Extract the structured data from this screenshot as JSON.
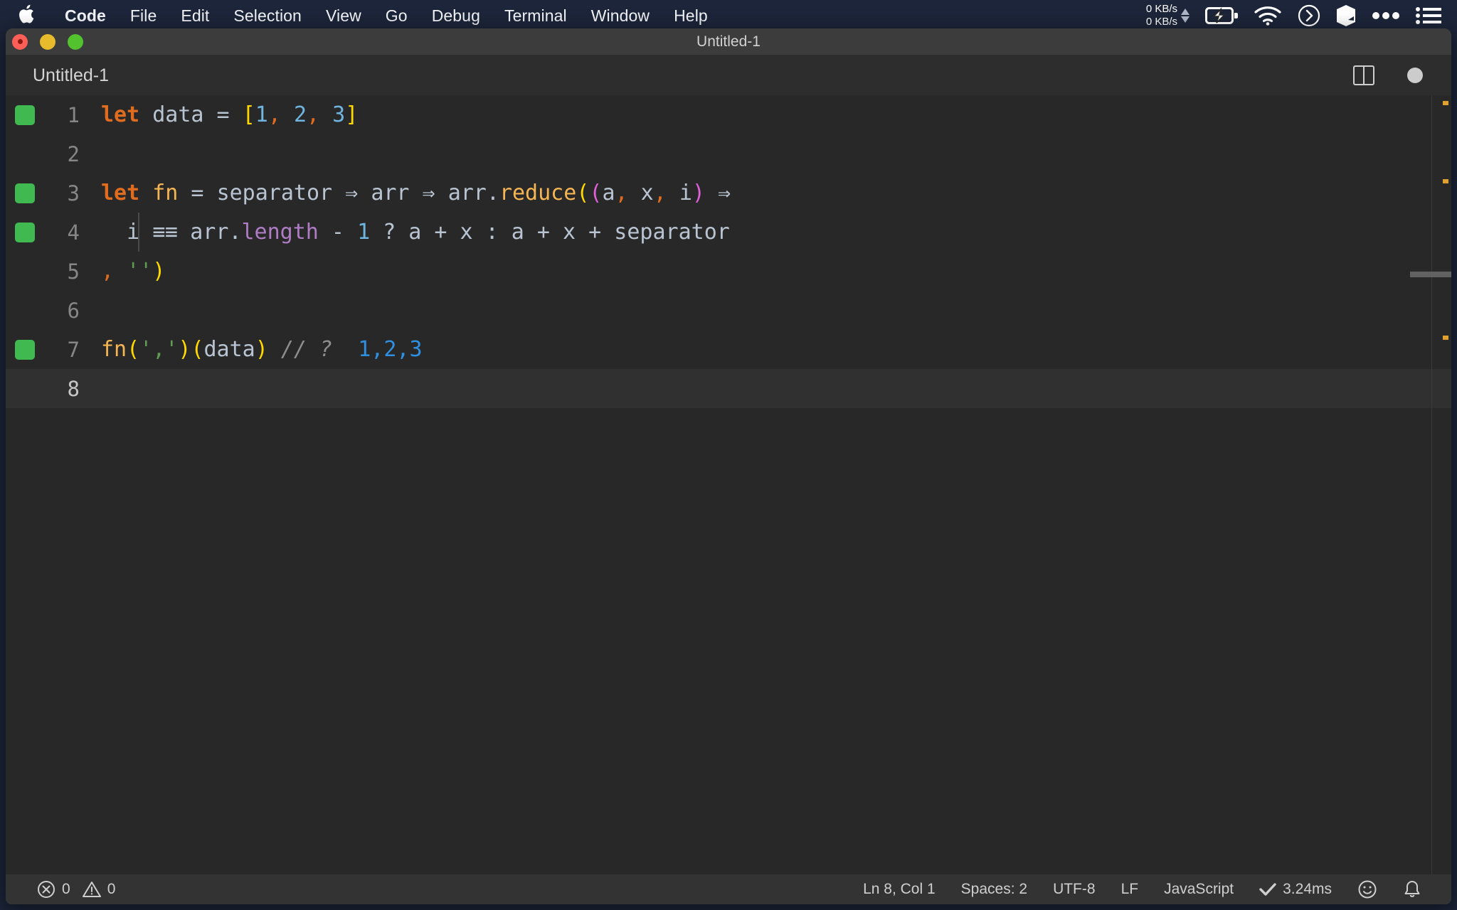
{
  "menubar": {
    "apple_icon": "apple-logo-icon",
    "items": [
      {
        "label": "Code",
        "bold": true
      },
      {
        "label": "File",
        "bold": false
      },
      {
        "label": "Edit",
        "bold": false
      },
      {
        "label": "Selection",
        "bold": false
      },
      {
        "label": "View",
        "bold": false
      },
      {
        "label": "Go",
        "bold": false
      },
      {
        "label": "Debug",
        "bold": false
      },
      {
        "label": "Terminal",
        "bold": false
      },
      {
        "label": "Window",
        "bold": false
      },
      {
        "label": "Help",
        "bold": false
      }
    ],
    "status_icons": {
      "net_up": "0 KB/s",
      "net_down": "0 KB/s",
      "battery": "battery-charging-icon",
      "wifi": "wifi-icon",
      "chevron_circle": "chevron-right-circle-icon",
      "cube": "cube-icon",
      "ellipsis": "ellipsis-icon",
      "list": "list-icon"
    }
  },
  "window": {
    "title": "Untitled-1",
    "traffic_lights": [
      "close-button",
      "minimize-button",
      "maximize-button"
    ]
  },
  "tabbar": {
    "tabs": [
      {
        "label": "Untitled-1",
        "active": true
      }
    ],
    "actions": {
      "split_editor": "split-editor-icon",
      "unsaved_indicator": "unsaved-dot-icon"
    }
  },
  "editor": {
    "language": "JavaScript",
    "active_line": 8,
    "lines": [
      {
        "no": "1",
        "marker": true,
        "indent_guide": false,
        "active": false,
        "tokens": [
          {
            "t": "let",
            "c": "t-key"
          },
          {
            "t": " ",
            "c": "t-op"
          },
          {
            "t": "data",
            "c": "t-var"
          },
          {
            "t": " = ",
            "c": "t-op"
          },
          {
            "t": "[",
            "c": "t-brk-y"
          },
          {
            "t": "1",
            "c": "t-num"
          },
          {
            "t": ",",
            "c": "t-comma"
          },
          {
            "t": " ",
            "c": "t-op"
          },
          {
            "t": "2",
            "c": "t-num"
          },
          {
            "t": ",",
            "c": "t-comma"
          },
          {
            "t": " ",
            "c": "t-op"
          },
          {
            "t": "3",
            "c": "t-num"
          },
          {
            "t": "]",
            "c": "t-brk-y"
          }
        ]
      },
      {
        "no": "2",
        "marker": false,
        "indent_guide": false,
        "active": false,
        "tokens": []
      },
      {
        "no": "3",
        "marker": true,
        "indent_guide": false,
        "active": false,
        "tokens": [
          {
            "t": "let",
            "c": "t-key"
          },
          {
            "t": " ",
            "c": "t-op"
          },
          {
            "t": "fn",
            "c": "t-fn"
          },
          {
            "t": " = ",
            "c": "t-op"
          },
          {
            "t": "separator",
            "c": "t-var"
          },
          {
            "t": " ⇒ ",
            "c": "t-op"
          },
          {
            "t": "arr",
            "c": "t-var"
          },
          {
            "t": " ⇒ ",
            "c": "t-op"
          },
          {
            "t": "arr",
            "c": "t-var"
          },
          {
            "t": ".",
            "c": "t-op"
          },
          {
            "t": "reduce",
            "c": "t-fn"
          },
          {
            "t": "(",
            "c": "t-brk-y"
          },
          {
            "t": "(",
            "c": "t-brk-m"
          },
          {
            "t": "a",
            "c": "t-var"
          },
          {
            "t": ",",
            "c": "t-comma"
          },
          {
            "t": " ",
            "c": "t-op"
          },
          {
            "t": "x",
            "c": "t-var"
          },
          {
            "t": ",",
            "c": "t-comma"
          },
          {
            "t": " ",
            "c": "t-op"
          },
          {
            "t": "i",
            "c": "t-var"
          },
          {
            "t": ")",
            "c": "t-brk-m"
          },
          {
            "t": " ⇒",
            "c": "t-op"
          }
        ]
      },
      {
        "no": "4",
        "marker": true,
        "indent_guide": true,
        "active": false,
        "tokens": [
          {
            "t": "  i ",
            "c": "t-var"
          },
          {
            "t": "≡≡",
            "c": "t-op t-lig"
          },
          {
            "t": " ",
            "c": "t-op"
          },
          {
            "t": "arr",
            "c": "t-var"
          },
          {
            "t": ".",
            "c": "t-op"
          },
          {
            "t": "length",
            "c": "t-prop"
          },
          {
            "t": " - ",
            "c": "t-op"
          },
          {
            "t": "1",
            "c": "t-num"
          },
          {
            "t": " ? a + x : a + x + separator",
            "c": "t-var"
          }
        ]
      },
      {
        "no": "5",
        "marker": false,
        "indent_guide": false,
        "active": false,
        "tokens": [
          {
            "t": ",",
            "c": "t-comma"
          },
          {
            "t": " ",
            "c": "t-op"
          },
          {
            "t": "''",
            "c": "t-str"
          },
          {
            "t": ")",
            "c": "t-brk-y"
          }
        ]
      },
      {
        "no": "6",
        "marker": false,
        "indent_guide": false,
        "active": false,
        "tokens": []
      },
      {
        "no": "7",
        "marker": true,
        "indent_guide": false,
        "active": false,
        "tokens": [
          {
            "t": "fn",
            "c": "t-fn"
          },
          {
            "t": "(",
            "c": "t-brk-y"
          },
          {
            "t": "','",
            "c": "t-str"
          },
          {
            "t": ")",
            "c": "t-brk-y"
          },
          {
            "t": "(",
            "c": "t-brk-y"
          },
          {
            "t": "data",
            "c": "t-var"
          },
          {
            "t": ")",
            "c": "t-brk-y"
          },
          {
            "t": " // ? ",
            "c": "t-comment"
          },
          {
            "t": " 1,2,3",
            "c": "t-result"
          }
        ]
      },
      {
        "no": "8",
        "marker": false,
        "indent_guide": false,
        "active": true,
        "tokens": []
      }
    ]
  },
  "statusbar": {
    "errors_icon": "error-circle-icon",
    "errors": "0",
    "warnings_icon": "warning-triangle-icon",
    "warnings": "0",
    "cursor_position": "Ln 8, Col 1",
    "indentation": "Spaces: 2",
    "encoding": "UTF-8",
    "eol": "LF",
    "language_mode": "JavaScript",
    "check_icon": "checkmark-icon",
    "run_time": "3.24ms",
    "feedback_icon": "smiley-icon",
    "notifications_icon": "bell-icon"
  },
  "colors": {
    "menubar_bg": "#1c2539",
    "titlebar_bg": "#3c3c3c",
    "tabbar_bg": "#2d2d2d",
    "editor_bg": "#282828",
    "statusbar_bg": "#333333",
    "gutter_marker": "#3fb950",
    "keyword": "#e06c20",
    "function": "#f5b553",
    "number": "#6fb5e0",
    "string": "#5f9c4f",
    "bracket_yellow": "#ffd900",
    "bracket_magenta": "#e060d8",
    "property": "#b07cc6",
    "comment": "#8d8d8d",
    "result": "#2f8fe0"
  }
}
